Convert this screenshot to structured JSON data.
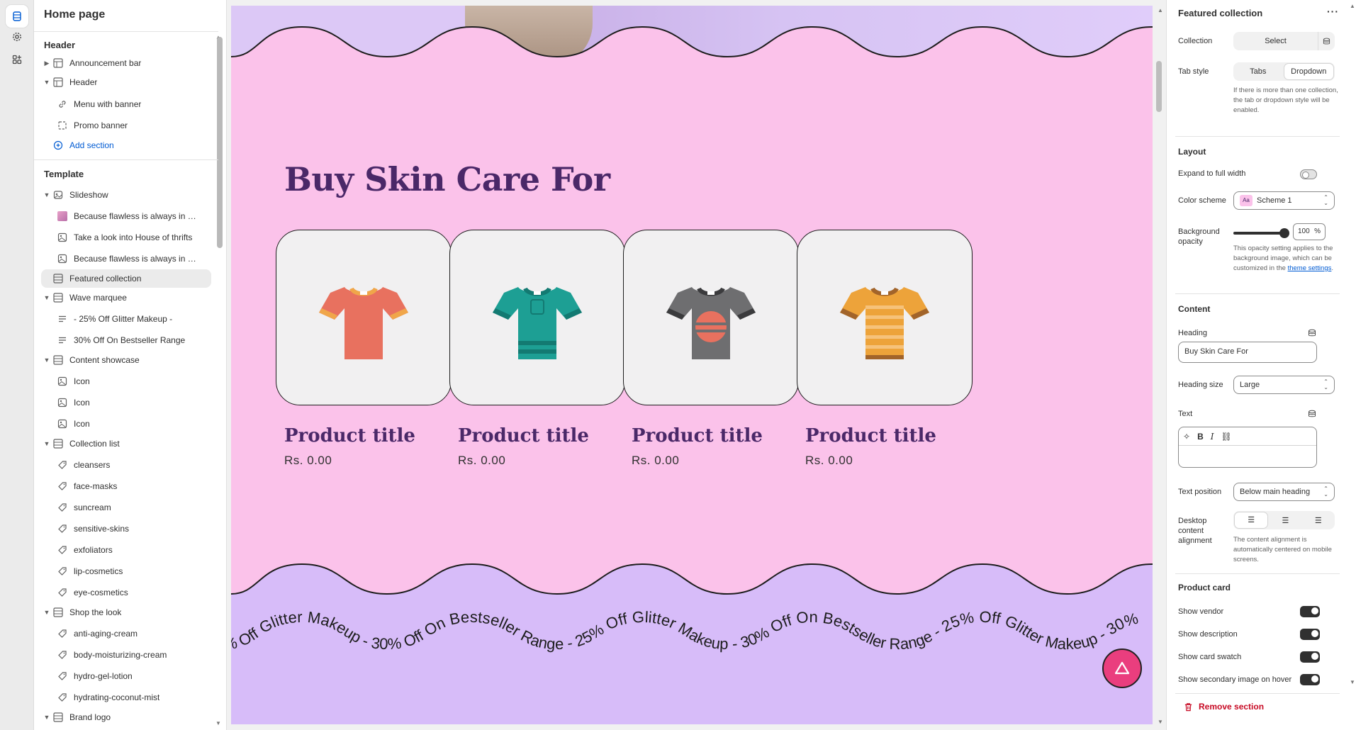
{
  "left_panel": {
    "page_title": "Home page",
    "header_group": "Header",
    "header_items": [
      {
        "label": "Announcement bar"
      },
      {
        "label": "Header"
      },
      {
        "label": "Menu with banner"
      },
      {
        "label": "Promo banner"
      }
    ],
    "add_section": "Add section",
    "template_group": "Template",
    "template_items": [
      {
        "label": "Slideshow"
      },
      {
        "label": "Because flawless is always in st..."
      },
      {
        "label": "Take a look into House of thrifts"
      },
      {
        "label": "Because flawless is always in st..."
      },
      {
        "label": "Featured collection"
      },
      {
        "label": "Wave marquee"
      },
      {
        "label": "- 25% Off Glitter Makeup -"
      },
      {
        "label": "30% Off On Bestseller Range"
      },
      {
        "label": "Content showcase"
      },
      {
        "label": "Icon"
      },
      {
        "label": "Icon"
      },
      {
        "label": "Icon"
      },
      {
        "label": "Collection list"
      },
      {
        "label": "cleansers"
      },
      {
        "label": "face-masks"
      },
      {
        "label": "suncream"
      },
      {
        "label": "sensitive-skins"
      },
      {
        "label": "exfoliators"
      },
      {
        "label": "lip-cosmetics"
      },
      {
        "label": "eye-cosmetics"
      },
      {
        "label": "Shop the look"
      },
      {
        "label": "anti-aging-cream"
      },
      {
        "label": "body-moisturizing-cream"
      },
      {
        "label": "hydro-gel-lotion"
      },
      {
        "label": "hydrating-coconut-mist"
      },
      {
        "label": "Brand logo"
      }
    ]
  },
  "preview": {
    "heading": "Buy Skin Care For",
    "products": [
      {
        "title": "Product title",
        "price": "Rs. 0.00",
        "color": "#e8715f"
      },
      {
        "title": "Product title",
        "price": "Rs. 0.00",
        "color": "#1d9f94"
      },
      {
        "title": "Product title",
        "price": "Rs. 0.00",
        "color": "#6e6e70"
      },
      {
        "title": "Product title",
        "price": "Rs. 0.00",
        "color": "#eda33a"
      }
    ],
    "marquee_text": "% Off Glitter Makeup - 30% Off On Bestseller Range - 25% Off Glitter Makeup - 30% Off On Bestseller Range - 25% Off Glitter Makeup - 30%",
    "background_color": "#fbc2ea",
    "band_color": "#d7bcf9",
    "fab_color": "#ea3e7e"
  },
  "right_panel": {
    "title": "Featured collection",
    "collection_label": "Collection",
    "collection_button": "Select",
    "tab_style_label": "Tab style",
    "tab_style_options": [
      "Tabs",
      "Dropdown"
    ],
    "tab_style_selected": "Dropdown",
    "tab_style_help": "If there is more than one collection, the tab or dropdown style will be enabled.",
    "layout_heading": "Layout",
    "expand_label": "Expand to full width",
    "expand_on": false,
    "color_scheme_label": "Color scheme",
    "color_scheme_badge": "Aa",
    "color_scheme_value": "Scheme 1",
    "bg_opacity_label": "Background opacity",
    "bg_opacity_value": "100",
    "bg_opacity_unit": "%",
    "bg_opacity_level": 1.0,
    "bg_help_prefix": "This opacity setting applies to the background image, which can be customized in the",
    "bg_help_link": "theme settings",
    "bg_help_suffix": ".",
    "content_heading": "Content",
    "heading_label": "Heading",
    "heading_value": "Buy Skin Care For",
    "heading_size_label": "Heading size",
    "heading_size_value": "Large",
    "text_label": "Text",
    "text_position_label": "Text position",
    "text_position_value": "Below main heading",
    "alignment_label": "Desktop content alignment",
    "alignment_help": "The content alignment is automatically centered on mobile screens.",
    "product_card_heading": "Product card",
    "toggles": [
      {
        "label": "Show vendor",
        "on": true
      },
      {
        "label": "Show description",
        "on": true
      },
      {
        "label": "Show card swatch",
        "on": true
      },
      {
        "label": "Show secondary image on hover",
        "on": true
      }
    ],
    "remove_section": "Remove section"
  }
}
